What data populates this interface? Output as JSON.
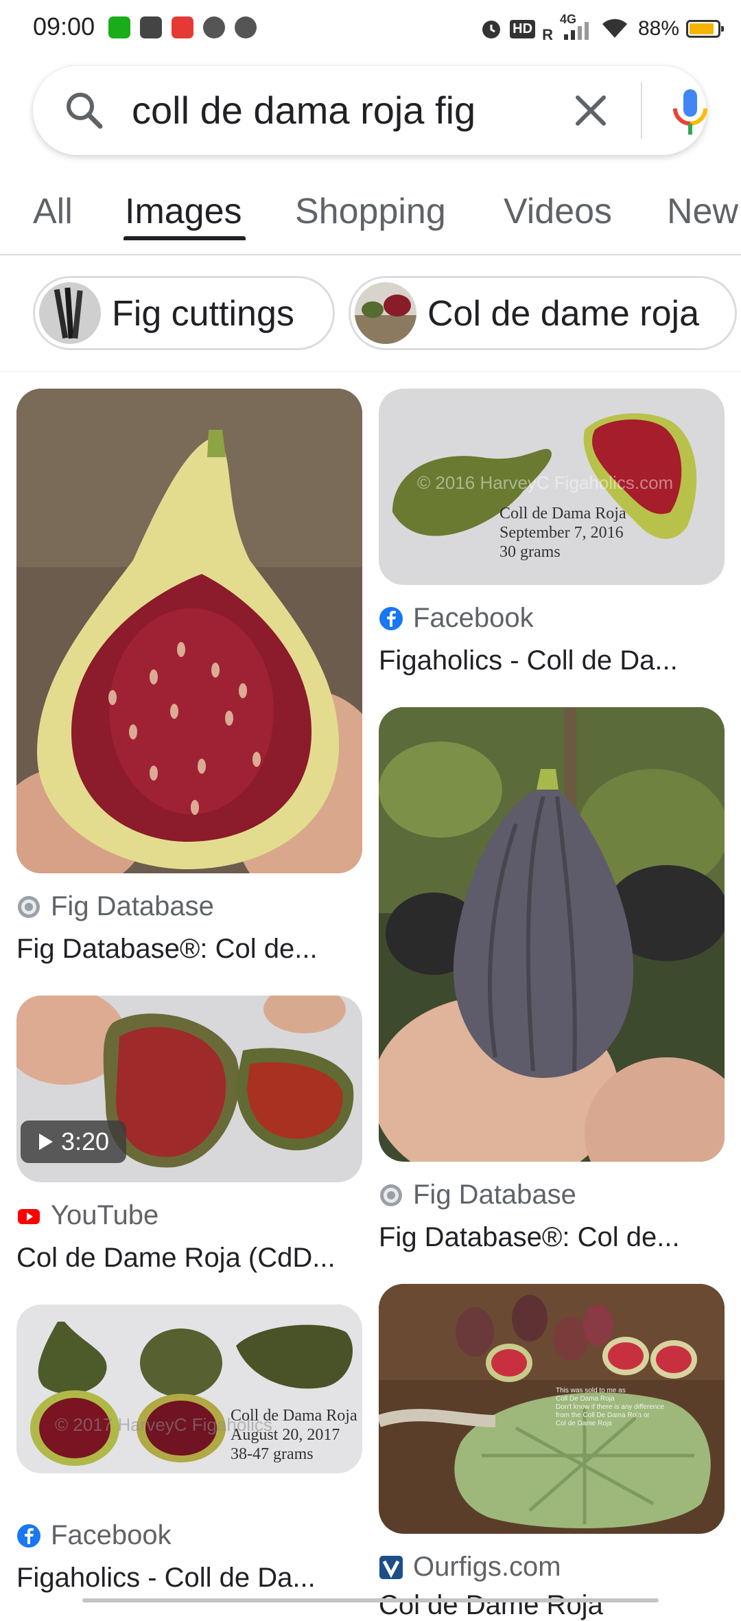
{
  "status_bar": {
    "time": "09:00",
    "battery": "88%",
    "battery_level": 0.88,
    "network": "4G",
    "hd": "HD",
    "roaming": "R"
  },
  "search": {
    "query": "coll de dama roja fig",
    "clear_icon": "close-icon",
    "mic_icon": "microphone-icon"
  },
  "tabs": [
    {
      "label": "All"
    },
    {
      "label": "Images",
      "active": true
    },
    {
      "label": "Shopping"
    },
    {
      "label": "Videos"
    },
    {
      "label": "New"
    }
  ],
  "chips": [
    {
      "label": "Fig cuttings"
    },
    {
      "label": "Col de dame roja"
    }
  ],
  "results": [
    {
      "source": "Fig Database",
      "title": "Fig Database®: Col de...",
      "source_icon": "globe-icon"
    },
    {
      "source": "Facebook",
      "title": "Figaholics - Coll de Da...",
      "source_icon": "facebook-icon",
      "thumb_watermark": "© 2016 HarveyC Figaholics.com",
      "thumb_caption": [
        "Coll de Dama Roja",
        "September 7, 2016",
        "30 grams"
      ]
    },
    {
      "source": "Fig Database",
      "title": "Fig Database®: Col de...",
      "source_icon": "globe-icon"
    },
    {
      "source": "YouTube",
      "title": "Col de Dame Roja (CdD...",
      "source_icon": "youtube-icon",
      "duration": "3:20"
    },
    {
      "source": "Facebook",
      "title": "Figaholics - Coll de Da...",
      "source_icon": "facebook-icon",
      "thumb_watermark": "© 2017 HarveyC Figaholics",
      "thumb_caption": [
        "Coll de Dama Roja",
        "August 20, 2017",
        "38-47 grams"
      ]
    },
    {
      "source": "Ourfigs.com",
      "title": "Col de Dame Roja",
      "source_icon": "ourfigs-icon",
      "thumb_caption": [
        "This was sold to me as",
        "Coll De Dama Roja",
        "Don't know if there is any difference",
        "from the Coll De Dama Roja or",
        "Col de Dame Roja"
      ]
    }
  ],
  "colors": {
    "accent_blue": "#4285f4",
    "accent_red": "#ea4335",
    "accent_yellow": "#fbbc05",
    "accent_green": "#34a853",
    "text_primary": "#202124",
    "text_secondary": "#5f6368"
  }
}
